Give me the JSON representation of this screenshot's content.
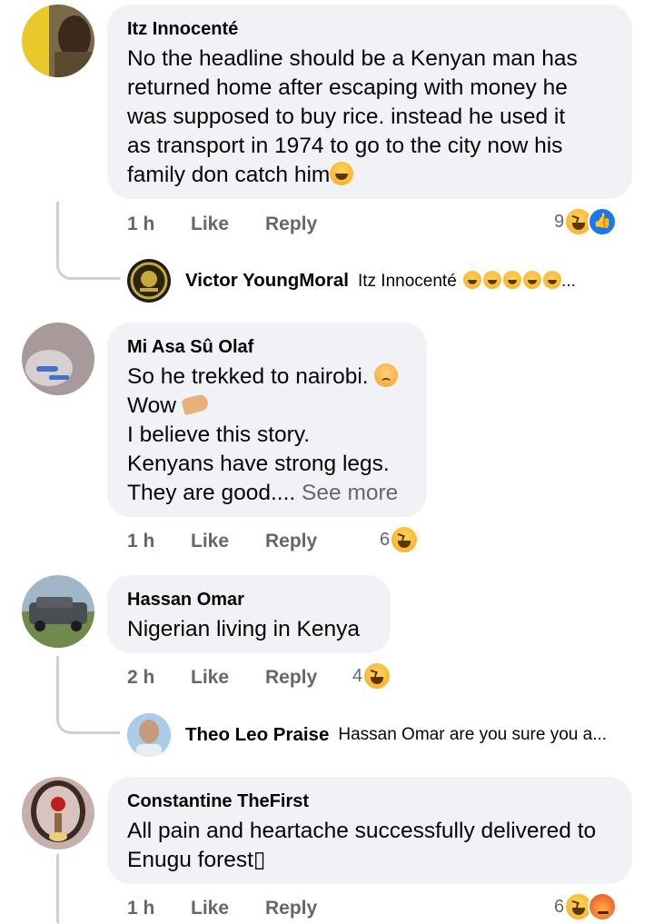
{
  "comments": [
    {
      "author": "Itz Innocenté",
      "lines": [
        "No the headline should be  a Kenyan man has",
        "returned home after escaping with money he",
        "was supposed to buy rice.  instead he used it",
        "as transport in 1974 to go  to the city now his",
        "family don catch him"
      ],
      "time": "1 h",
      "like": "Like",
      "reply": "Reply",
      "reaction_count": "9",
      "reactions": [
        "haha-icon",
        "like-icon"
      ],
      "reply_preview": {
        "name": "Victor YoungMoral",
        "text": "Itz Innocenté",
        "suffix": "..."
      }
    },
    {
      "author": "Mi Asa Sû Olaf",
      "lines": [
        "So he trekked to nairobi.",
        "Wow",
        "I believe this story.",
        "Kenyans have strong legs.",
        "They are good...."
      ],
      "see_more": "See more",
      "time": "1 h",
      "like": "Like",
      "reply": "Reply",
      "reaction_count": "6",
      "reactions": [
        "haha-icon"
      ]
    },
    {
      "author": "Hassan Omar",
      "lines": [
        "Nigerian living in Kenya"
      ],
      "time": "2 h",
      "like": "Like",
      "reply": "Reply",
      "reaction_count": "4",
      "reactions": [
        "haha-icon"
      ],
      "reply_preview": {
        "name": "Theo Leo Praise",
        "text": "Hassan Omar are you sure you a..."
      }
    },
    {
      "author": "Constantine TheFirst",
      "lines": [
        "All pain and heartache successfully delivered to",
        "Enugu forest▯"
      ],
      "time": "1 h",
      "like": "Like",
      "reply": "Reply",
      "reaction_count": "6",
      "reactions": [
        "haha-icon",
        "angry-icon"
      ]
    }
  ],
  "colors": {
    "bubble": "#f0f2f5",
    "meta": "#65676b",
    "like_blue": "#1877f2"
  }
}
